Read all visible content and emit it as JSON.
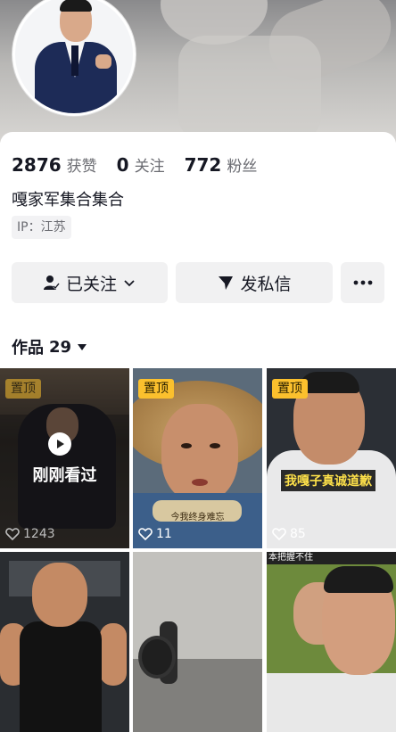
{
  "profile": {
    "stats": [
      {
        "num": "2876",
        "label": "获赞"
      },
      {
        "num": "0",
        "label": "关注"
      },
      {
        "num": "772",
        "label": "粉丝"
      }
    ],
    "name": "嘎家军集合集合",
    "ip": "IP：江苏"
  },
  "actions": {
    "follow_label": "已关注",
    "message_label": "发私信"
  },
  "works": {
    "label": "作品",
    "count": "29"
  },
  "videos": [
    {
      "pinned": "置顶",
      "likes": "1243",
      "overlay": "刚刚看过"
    },
    {
      "pinned": "置顶",
      "likes": "11",
      "caption": "今我终身难忘"
    },
    {
      "pinned": "置顶",
      "likes": "85",
      "caption": "我嘎子真诚道歉"
    },
    {},
    {},
    {
      "caption": "本把握不住"
    }
  ],
  "colors": {
    "pin_badge": "#fbc02d",
    "button_bg": "#f1f1f2",
    "text_secondary": "#6b6c72"
  }
}
